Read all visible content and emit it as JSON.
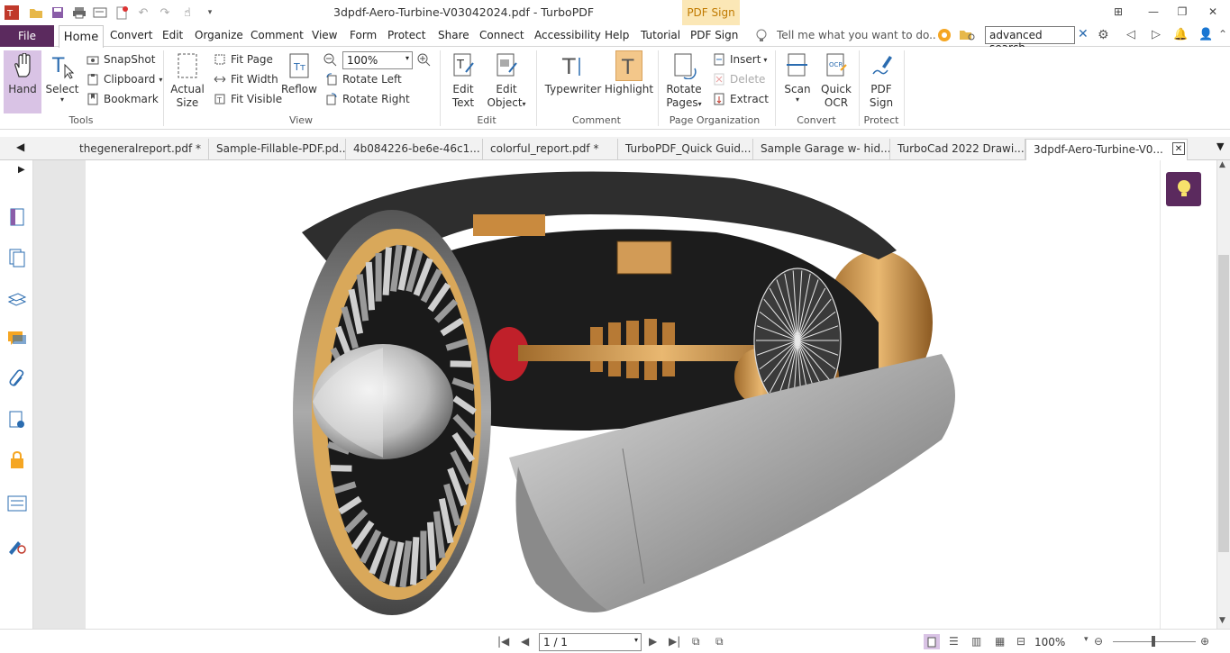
{
  "window": {
    "title": "3dpdf-Aero-Turbine-V03042024.pdf - TurboPDF",
    "context_tab": "PDF Sign"
  },
  "menubar": {
    "file": "File",
    "items": [
      "Home",
      "Convert",
      "Edit",
      "Organize",
      "Comment",
      "View",
      "Form",
      "Protect",
      "Share",
      "Connect",
      "Accessibility",
      "Help",
      "Tutorial",
      "PDF Sign"
    ],
    "tell_me": "Tell me what you want to do..",
    "search_value": "advanced search"
  },
  "ribbon": {
    "tools": {
      "hand": "Hand",
      "select": "Select",
      "snapshot": "SnapShot",
      "clipboard": "Clipboard",
      "bookmark": "Bookmark",
      "label": "Tools"
    },
    "view": {
      "actual_size_1": "Actual",
      "actual_size_2": "Size",
      "fit_page": "Fit Page",
      "fit_width": "Fit Width",
      "fit_visible": "Fit Visible",
      "reflow": "Reflow",
      "zoom": "100%",
      "rotate_left": "Rotate Left",
      "rotate_right": "Rotate Right",
      "label": "View"
    },
    "edit": {
      "edit_text_1": "Edit",
      "edit_text_2": "Text",
      "edit_object_1": "Edit",
      "edit_object_2": "Object",
      "label": "Edit"
    },
    "comment": {
      "typewriter": "Typewriter",
      "highlight": "Highlight",
      "label": "Comment"
    },
    "page_org": {
      "rotate_pages_1": "Rotate",
      "rotate_pages_2": "Pages",
      "insert": "Insert",
      "delete": "Delete",
      "extract": "Extract",
      "label": "Page Organization"
    },
    "convert": {
      "scan": "Scan",
      "quick_ocr_1": "Quick",
      "quick_ocr_2": "OCR",
      "label": "Convert"
    },
    "protect": {
      "pdf_sign_1": "PDF",
      "pdf_sign_2": "Sign",
      "label": "Protect"
    }
  },
  "tabs": [
    "thegeneralreport.pdf *",
    "Sample-Fillable-PDF.pd...",
    "4b084226-be6e-46c1...",
    "colorful_report.pdf *",
    "TurboPDF_Quick Guid...",
    "Sample Garage w- hid...",
    "TurboCad 2022 Drawi...",
    "3dpdf-Aero-Turbine-V0..."
  ],
  "status": {
    "page": "1 / 1",
    "zoom": "100%"
  },
  "colors": {
    "accent": "#5b2a5e",
    "context": "#fbe7b6",
    "highlight": "#f3c78a"
  },
  "icons": [
    "hand-icon",
    "select-icon",
    "snapshot-icon",
    "clipboard-icon",
    "bookmark-icon",
    "lightbulb-icon"
  ]
}
